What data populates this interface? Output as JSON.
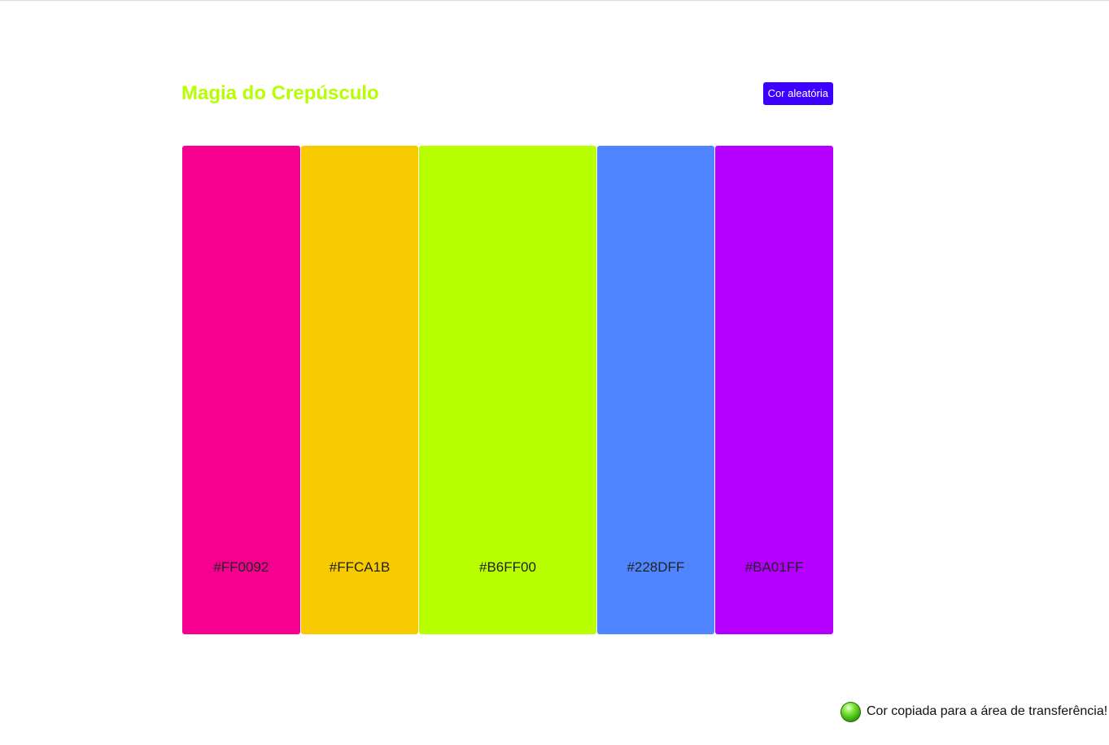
{
  "header": {
    "title": "Magia do Crepúsculo",
    "random_button_label": "Cor aleatória"
  },
  "palette": {
    "colors": [
      {
        "hex": "#FF0092",
        "fill": "#f5008f",
        "width_share": 1
      },
      {
        "hex": "#FFCA1B",
        "fill": "#f7cb00",
        "width_share": 1
      },
      {
        "hex": "#B6FF00",
        "fill": "#b8ff00",
        "width_share": 1.5
      },
      {
        "hex": "#228DFF",
        "fill": "#4f86ff",
        "width_share": 1
      },
      {
        "hex": "#BA01FF",
        "fill": "#b600ff",
        "width_share": 1
      }
    ]
  },
  "toast": {
    "message": "Cor copiada para a área de transferência!"
  }
}
